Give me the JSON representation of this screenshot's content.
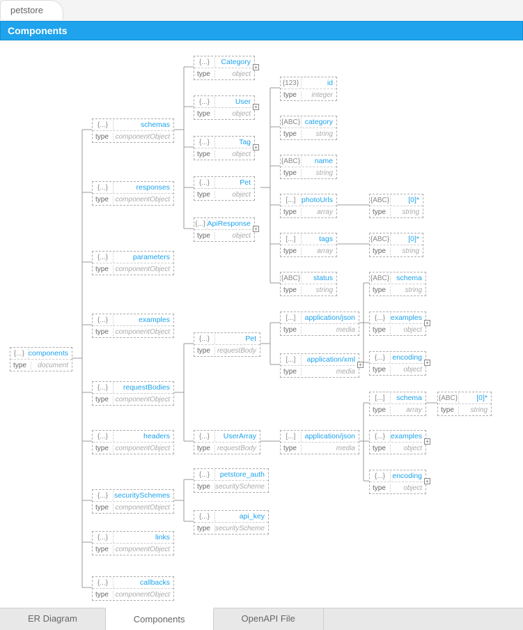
{
  "top_tab": "petstore",
  "header": "Components",
  "bottom_tabs": [
    "ER Diagram",
    "Components",
    "OpenAPI File"
  ],
  "active_tab": 1,
  "type_label": "type",
  "icons": {
    "braces": "{...}",
    "bracket": "[...]",
    "num": "{123}",
    "str": "{ABC}"
  },
  "type_values": {
    "document": "document",
    "componentObject": "componentObject",
    "object": "object",
    "integer": "integer",
    "string": "string",
    "array": "array",
    "requestBody": "requestBody",
    "media": "media",
    "securityScheme": "securityScheme"
  },
  "nodes": {
    "root": {
      "title": "components",
      "type": "document",
      "icon": "braces"
    },
    "schemas": {
      "title": "schemas",
      "type": "componentObject",
      "icon": "braces"
    },
    "responses": {
      "title": "responses",
      "type": "componentObject",
      "icon": "braces"
    },
    "parameters": {
      "title": "parameters",
      "type": "componentObject",
      "icon": "braces"
    },
    "examples": {
      "title": "examples",
      "type": "componentObject",
      "icon": "braces"
    },
    "requestBodies": {
      "title": "requestBodies",
      "type": "componentObject",
      "icon": "braces"
    },
    "headers": {
      "title": "headers",
      "type": "componentObject",
      "icon": "braces"
    },
    "securitySchemes": {
      "title": "securitySchemes",
      "type": "componentObject",
      "icon": "braces"
    },
    "links": {
      "title": "links",
      "type": "componentObject",
      "icon": "braces"
    },
    "callbacks": {
      "title": "callbacks",
      "type": "componentObject",
      "icon": "braces"
    },
    "Category": {
      "title": "Category",
      "type": "object",
      "icon": "braces"
    },
    "User": {
      "title": "User",
      "type": "object",
      "icon": "braces"
    },
    "Tag": {
      "title": "Tag",
      "type": "object",
      "icon": "braces"
    },
    "Pet": {
      "title": "Pet",
      "type": "object",
      "icon": "braces"
    },
    "ApiResponse": {
      "title": "ApiResponse",
      "type": "object",
      "icon": "braces"
    },
    "id": {
      "title": "id",
      "type": "integer",
      "icon": "num"
    },
    "category": {
      "title": "category",
      "type": "string",
      "icon": "str"
    },
    "name": {
      "title": "name",
      "type": "string",
      "icon": "str"
    },
    "photoUrls": {
      "title": "photoUrls",
      "type": "array",
      "icon": "bracket"
    },
    "tags": {
      "title": "tags",
      "type": "array",
      "icon": "bracket"
    },
    "status": {
      "title": "status",
      "type": "string",
      "icon": "str"
    },
    "photoUrls_item": {
      "title": "[0]*",
      "type": "string",
      "icon": "str"
    },
    "tags_item": {
      "title": "[0]*",
      "type": "string",
      "icon": "str"
    },
    "schema1": {
      "title": "schema",
      "type": "string",
      "icon": "str"
    },
    "examples1": {
      "title": "examples",
      "type": "object",
      "icon": "braces"
    },
    "encoding1": {
      "title": "encoding",
      "type": "object",
      "icon": "braces"
    },
    "PetRB": {
      "title": "Pet",
      "type": "requestBody",
      "icon": "braces"
    },
    "UserArray": {
      "title": "UserArray",
      "type": "requestBody",
      "icon": "braces"
    },
    "app_json1": {
      "title": "application/json",
      "type": "media",
      "icon": "bracket"
    },
    "app_xml1": {
      "title": "application/xml",
      "type": "media",
      "icon": "bracket"
    },
    "app_json2": {
      "title": "application/json",
      "type": "media",
      "icon": "bracket"
    },
    "schema2": {
      "title": "schema",
      "type": "array",
      "icon": "bracket"
    },
    "examples2": {
      "title": "examples",
      "type": "object",
      "icon": "braces"
    },
    "encoding2": {
      "title": "encoding",
      "type": "object",
      "icon": "braces"
    },
    "schema2_item": {
      "title": "[0]*",
      "type": "string",
      "icon": "str"
    },
    "petstore_auth": {
      "title": "petstore_auth",
      "type": "securityScheme",
      "icon": "braces"
    },
    "api_key": {
      "title": "api_key",
      "type": "securityScheme",
      "icon": "braces"
    }
  }
}
